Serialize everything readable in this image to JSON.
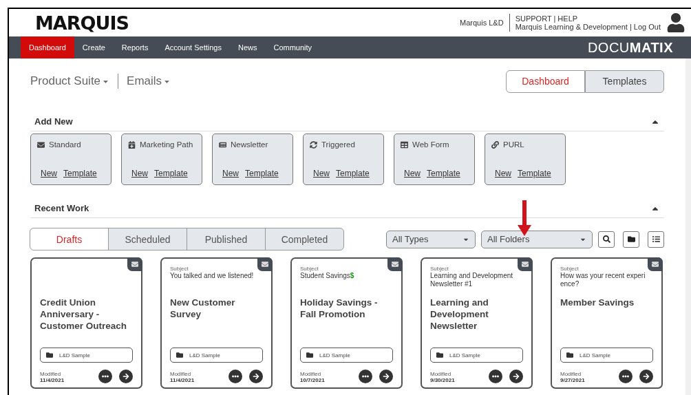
{
  "header": {
    "logo": "MARQUIS",
    "account": "Marquis L&D",
    "support": "SUPPORT | HELP",
    "org": "Marquis Learning & Development | Log Out"
  },
  "nav": {
    "items": [
      {
        "label": "Dashboard",
        "selected": true
      },
      {
        "label": "Create",
        "selected": false
      },
      {
        "label": "Reports",
        "selected": false
      },
      {
        "label": "Account Settings",
        "selected": false
      },
      {
        "label": "News",
        "selected": false
      },
      {
        "label": "Community",
        "selected": false
      }
    ],
    "brand": "DOCU**MATIX**"
  },
  "breadcrumb": [
    {
      "label": "Product Suite"
    },
    {
      "label": "Emails"
    }
  ],
  "view_toggle": [
    {
      "label": "Dashboard",
      "selected": true
    },
    {
      "label": "Templates",
      "selected": false
    }
  ],
  "add_new": {
    "title": "Add New",
    "types": [
      {
        "label": "Standard",
        "kind": "envelope",
        "links": [
          "New",
          "Template"
        ]
      },
      {
        "label": "Marketing Path",
        "kind": "calendar",
        "links": [
          "New",
          "Template"
        ]
      },
      {
        "label": "Newsletter",
        "kind": "newsletter",
        "links": [
          "New",
          "Template"
        ]
      },
      {
        "label": "Triggered",
        "kind": "refresh",
        "links": [
          "New",
          "Template"
        ]
      },
      {
        "label": "Web Form",
        "kind": "table",
        "links": [
          "New",
          "Template"
        ]
      },
      {
        "label": "PURL",
        "kind": "link",
        "links": [
          "New",
          "Template"
        ]
      }
    ]
  },
  "recent_work": {
    "title": "Recent Work",
    "tabs": [
      {
        "label": "Drafts",
        "selected": true
      },
      {
        "label": "Scheduled",
        "selected": false
      },
      {
        "label": "Published",
        "selected": false
      },
      {
        "label": "Completed",
        "selected": false
      }
    ],
    "filters": [
      {
        "value": "All Types"
      },
      {
        "value": "All Folders"
      }
    ],
    "cards": [
      {
        "title": "Credit Union Anniversary - Customer Outreach",
        "folder": "L&D Sample",
        "modified_label": "Modified",
        "modified": "11/4/2021"
      },
      {
        "subject_label": "Subject",
        "subject": "You talked and we listened!",
        "title": "New Customer Survey",
        "folder": "L&D Sample",
        "modified_label": "Modified",
        "modified": "11/4/2021"
      },
      {
        "subject_label": "Subject",
        "subject": "Student Savings",
        "subject_emoji": "$",
        "title": "Holiday Savings - Fall Promotion",
        "folder": "L&D Sample",
        "modified_label": "Modified",
        "modified": "10/7/2021"
      },
      {
        "subject_label": "Subject",
        "subject": "Learning and Development Newsletter #1",
        "title": "Learning and Development Newsletter",
        "folder": "L&D Sample",
        "modified_label": "Modified",
        "modified": "9/30/2021"
      },
      {
        "subject_label": "Subject",
        "subject": "How was your recent experi ence?",
        "title": "Member Savings",
        "folder": "L&D Sample",
        "modified_label": "Modified",
        "modified": "9/27/2021"
      }
    ]
  }
}
